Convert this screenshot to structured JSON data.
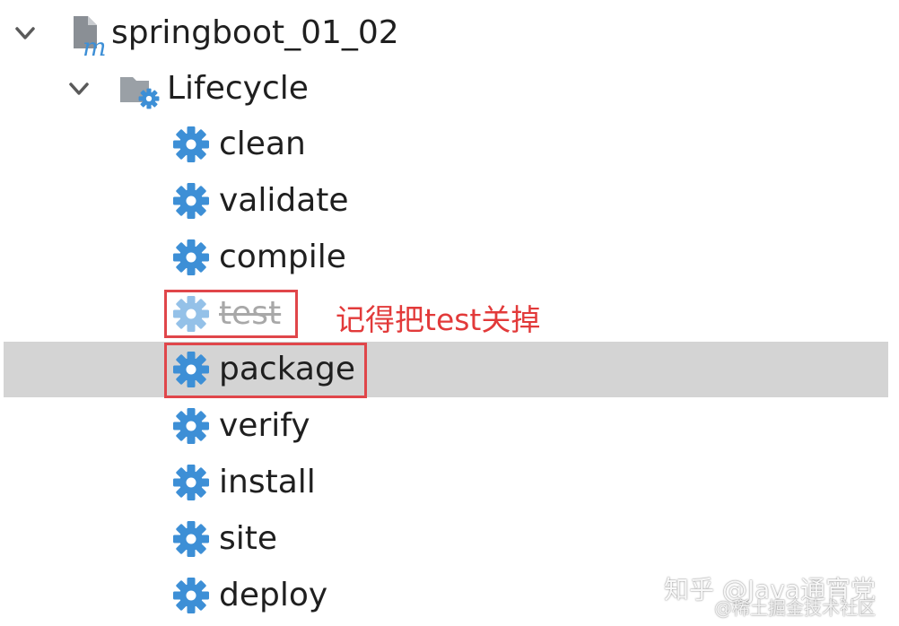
{
  "tree": {
    "project": {
      "label": "springboot_01_02",
      "icon": "maven-module-icon",
      "expanded": true
    },
    "lifecycle": {
      "label": "Lifecycle",
      "icon": "lifecycle-folder-icon",
      "expanded": true
    },
    "phases": [
      {
        "label": "clean",
        "icon": "gear-icon",
        "skipped": false,
        "selected": false
      },
      {
        "label": "validate",
        "icon": "gear-icon",
        "skipped": false,
        "selected": false
      },
      {
        "label": "compile",
        "icon": "gear-icon",
        "skipped": false,
        "selected": false
      },
      {
        "label": "test",
        "icon": "gear-icon",
        "skipped": true,
        "selected": false
      },
      {
        "label": "package",
        "icon": "gear-icon",
        "skipped": false,
        "selected": true
      },
      {
        "label": "verify",
        "icon": "gear-icon",
        "skipped": false,
        "selected": false
      },
      {
        "label": "install",
        "icon": "gear-icon",
        "skipped": false,
        "selected": false
      },
      {
        "label": "site",
        "icon": "gear-icon",
        "skipped": false,
        "selected": false
      },
      {
        "label": "deploy",
        "icon": "gear-icon",
        "skipped": false,
        "selected": false
      }
    ]
  },
  "annotation": {
    "text": "记得把test关掉",
    "color": "#e23a3a"
  },
  "watermark": {
    "line1": "知乎 @Java通宵党",
    "line2": "@稀土掘金技术社区"
  },
  "colors": {
    "gear": "#3d8fd6",
    "selection": "#d4d4d4",
    "highlight_box": "#e0464a"
  }
}
